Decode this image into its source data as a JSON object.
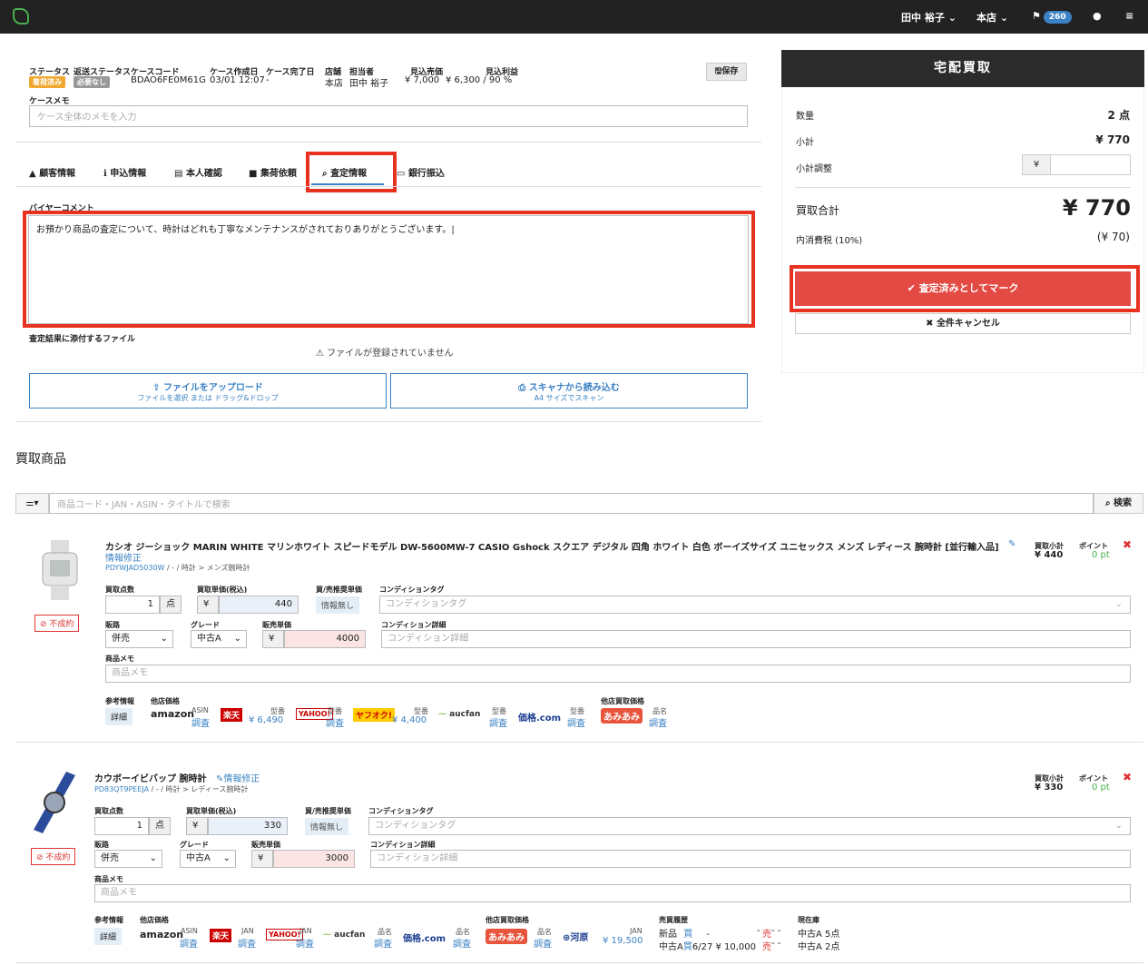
{
  "nav": {
    "user": "田中 裕子",
    "store": "本店",
    "flag_count": "260"
  },
  "case": {
    "status_label": "ステータス",
    "status_value": "着荷済み",
    "return_status_label": "返送ステータス",
    "return_status_value": "必要なし",
    "code_label": "ケースコード",
    "code_value": "BDAO6FE0M61G",
    "created_label": "ケース作成日",
    "created_value": "03/01 12:07",
    "completed_label": "ケース完了日",
    "completed_value": "-",
    "store_label": "店舗",
    "store_value": "本店",
    "staff_label": "担当者",
    "staff_value": "田中 裕子",
    "est_sales_label": "見込売価",
    "est_sales_value": "¥ 7,000",
    "est_profit_label": "見込利益",
    "est_profit_value": "¥ 6,300 / 90 %",
    "save_label": "保存",
    "memo_label": "ケースメモ",
    "memo_placeholder": "ケース全体のメモを入力"
  },
  "tabs": [
    "顧客情報",
    "申込情報",
    "本人確認",
    "集荷依頼",
    "査定情報",
    "銀行振込"
  ],
  "assessment": {
    "comment_label": "バイヤーコメント",
    "comment_value": "お預かり商品の査定について、時計はどれも丁寧なメンテナンスがされておりありがとうございます。|",
    "files_label": "査定結果に添付するファイル",
    "no_files": "ファイルが登録されていません",
    "upload_label": "ファイルをアップロード",
    "upload_sub": "ファイルを選択 または ドラッグ&ドロップ",
    "scan_label": "スキャナから読み込む",
    "scan_sub": "A4 サイズでスキャン"
  },
  "summary": {
    "title": "宅配買取",
    "qty_label": "数量",
    "qty_value": "2 点",
    "subtotal_label": "小計",
    "subtotal_value": "¥ 770",
    "adjust_label": "小計調整",
    "adjust_currency": "¥",
    "total_label": "買取合計",
    "total_value": "¥ 770",
    "tax_label": "内消費税 (10%)",
    "tax_value": "(¥ 70)",
    "mark_button": "査定済みとしてマーク",
    "cancel_button": "全件キャンセル"
  },
  "products": {
    "heading": "買取商品",
    "search_placeholder": "商品コード・JAN・ASIN・タイトルで検索",
    "search_button": "検索"
  },
  "labels": {
    "qty": "買取点数",
    "unit": "点",
    "buy_price": "買取単価(税込)",
    "rec": "買/売推奨単価",
    "cond_tag": "コンディションタグ",
    "cond_detail": "コンディション詳細",
    "channel": "販路",
    "grade": "グレード",
    "sell_price": "販売単価",
    "memo": "商品メモ",
    "ref": "参考情報",
    "other_price": "他店価格",
    "other_buy": "他店買取価格",
    "detail": "詳細",
    "subtotal": "買取小計",
    "point": "ポイント",
    "ng": "不成約",
    "edit": "情報修正",
    "no_info": "情報無し",
    "yen": "¥",
    "asin": "ASIN",
    "model": "型番",
    "jan": "JAN",
    "name": "品名",
    "search": "調査",
    "history": "売買履歴",
    "stock": "現在庫"
  },
  "item1": {
    "title": "カシオ ジーショック MARIN WHITE マリンホワイト スピードモデル DW-5600MW-7 CASIO Gshock スクエア デジタル 四角 ホワイト 白色 ボーイズサイズ ユニセックス メンズ レディース 腕時計 [並行輸入品]",
    "edit": "情報修正",
    "code": "PDYWJAD5030W",
    "category": "/ - / 時計 > メンズ腕時計",
    "qty": "1",
    "buy_price": "440",
    "channel": "併売",
    "grade": "中古A",
    "sell_price": "4000",
    "subtotal": "¥ 440",
    "point": "0 pt",
    "rakuten_price": "¥ 6,490",
    "yahoo_price": "¥ 4,400"
  },
  "item2": {
    "title": "カウボーイビバップ 腕時計",
    "code": "PD83QT9PEEJA",
    "category": "/ - / 時計 > レディース腕時計",
    "qty": "1",
    "buy_price": "330",
    "channel": "併売",
    "grade": "中古A",
    "sell_price": "3000",
    "subtotal": "¥ 330",
    "point": "0 pt",
    "kawaya_price": "¥ 19,500",
    "hist_new": "新品",
    "hist_used": "中古A",
    "hist_new_buy": "買",
    "hist_new_buy_val": "-",
    "hist_new_sell_val": "-",
    "hist_new_sell": "売",
    "hist_new_tail": "- -",
    "hist_used_buy": "買",
    "hist_used_buy_val": "6/27 ¥ 10,000",
    "hist_used_sell": "売",
    "hist_used_tail": "- -",
    "stock1": "中古A 5点",
    "stock2": "中古A 2点"
  },
  "brands": {
    "amazon": "amazon",
    "rakuten": "楽天",
    "yahoo": "YAHOO!",
    "yahuoku": "ヤフオク!",
    "aucfan": "aucfan",
    "kakaku": "価格.com",
    "amiami": "あみあみ",
    "kawaya": "河原"
  },
  "colors": {
    "accent": "#3b82c4",
    "danger": "#e34a43",
    "frame": "#e8321f",
    "topbar": "#222222"
  }
}
